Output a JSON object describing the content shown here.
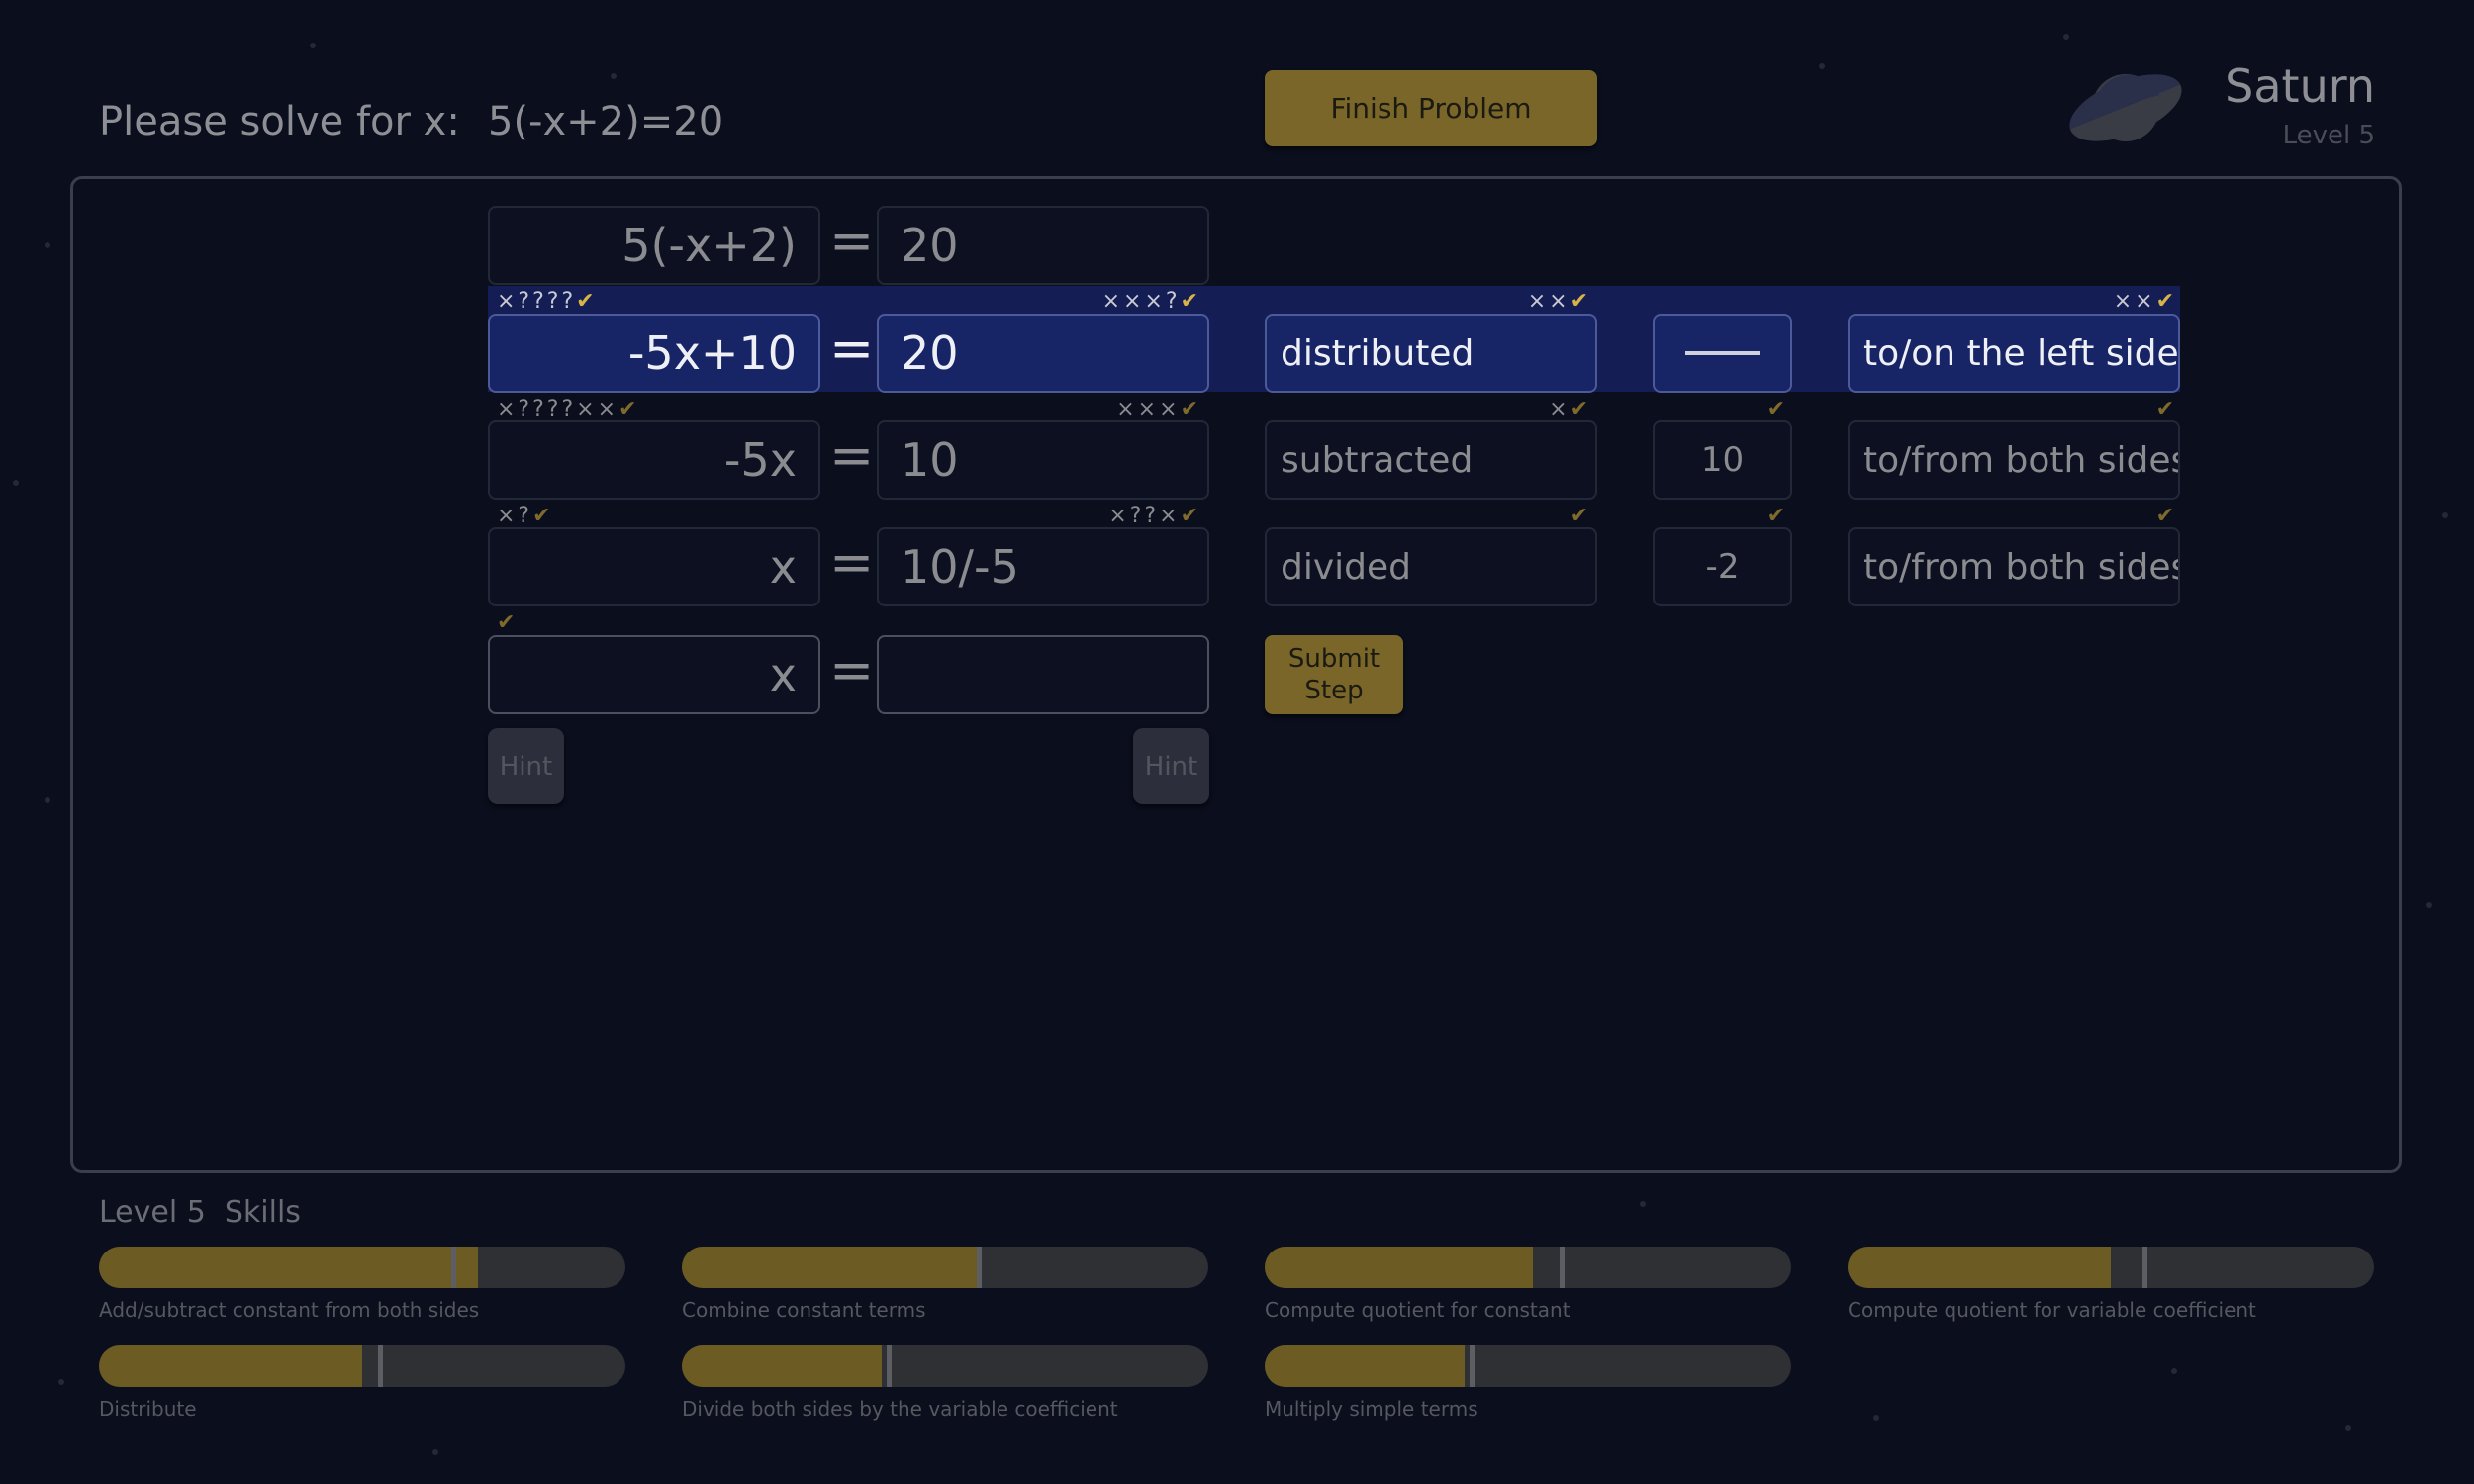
{
  "header": {
    "prompt": "Please solve for x:",
    "equation": "5(-x+2)=20",
    "finish_label": "Finish Problem",
    "planet_name": "Saturn",
    "level_label": "Level 5"
  },
  "steps": [
    {
      "left": "5(-x+2)",
      "equals": "=",
      "right": "20",
      "state": "given"
    },
    {
      "left": "-5x+10",
      "equals": "=",
      "right": "20",
      "left_marks": "×????",
      "right_marks": "×××?",
      "explain": "distributed",
      "explain_marks": "××",
      "value": "",
      "value_marks": "",
      "side": "to/on the left side",
      "side_marks": "××",
      "state": "active"
    },
    {
      "left": "-5x",
      "equals": "=",
      "right": "10",
      "left_marks": "×????××",
      "right_marks": "×××",
      "explain": "subtracted",
      "explain_marks": "×",
      "value": "10",
      "value_marks": "",
      "side": "to/from both sides",
      "side_marks": "",
      "state": "done"
    },
    {
      "left": "x",
      "equals": "=",
      "right": "10/-5",
      "left_marks": "×?",
      "right_marks": "×??×",
      "explain": "divided",
      "explain_marks": "",
      "value": "-2",
      "value_marks": "",
      "side": "to/from both sides",
      "side_marks": "",
      "state": "done"
    },
    {
      "left": "x",
      "equals": "=",
      "right": "",
      "state": "input"
    }
  ],
  "check_glyph": "✔",
  "submit_label": "Submit Step",
  "hint_label": "Hint",
  "skills_title": "Level 5  Skills",
  "skills": [
    {
      "name": "Add/subtract constant from both sides",
      "progress": 0.72,
      "threshold": 0.67
    },
    {
      "name": "Combine constant terms",
      "progress": 0.56,
      "threshold": 0.56
    },
    {
      "name": "Compute quotient for constant",
      "progress": 0.51,
      "threshold": 0.56
    },
    {
      "name": "Compute quotient for variable coefficient",
      "progress": 0.5,
      "threshold": 0.56
    },
    {
      "name": "Distribute",
      "progress": 0.5,
      "threshold": 0.53
    },
    {
      "name": "Divide both sides by the variable coefficient",
      "progress": 0.38,
      "threshold": 0.39
    },
    {
      "name": "Multiply simple terms",
      "progress": 0.38,
      "threshold": 0.39
    }
  ],
  "colors": {
    "background": "#0a0e1d",
    "accent_gold": "#7a6628",
    "active_row": "#141e55",
    "skill_fill": "#6d5b24"
  }
}
